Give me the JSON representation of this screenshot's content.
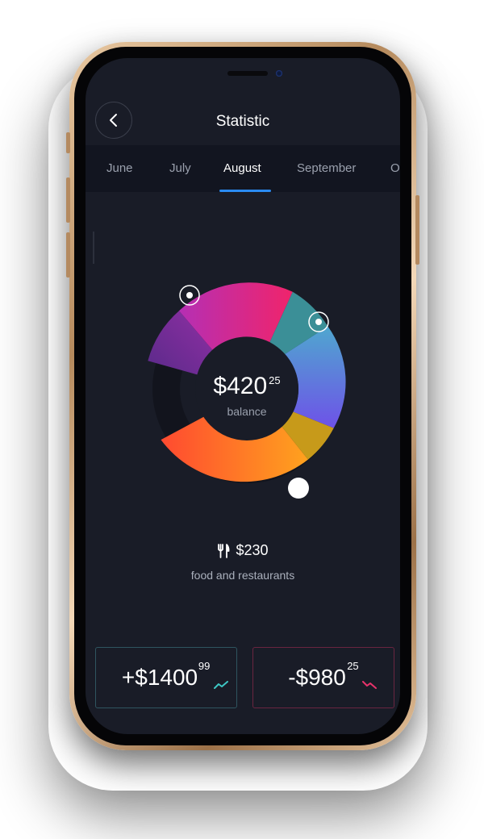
{
  "header": {
    "title": "Statistic"
  },
  "tabs": [
    {
      "label": "June",
      "active": false
    },
    {
      "label": "July",
      "active": false
    },
    {
      "label": "August",
      "active": true
    },
    {
      "label": "September",
      "active": false
    },
    {
      "label": "October",
      "active": false
    }
  ],
  "balance": {
    "amount": "$420",
    "cents": "25",
    "label": "balance"
  },
  "selected_category": {
    "icon": "fork-knife-icon",
    "amount": "$230",
    "label": "food and restaurants"
  },
  "income": {
    "amount": "+$1400",
    "cents": "99",
    "trend_icon": "trend-up-icon",
    "color": "#3ec7c4"
  },
  "expense": {
    "amount": "-$980",
    "cents": "25",
    "trend_icon": "trend-down-icon",
    "color": "#e8336b"
  },
  "colors": {
    "background": "#191c27",
    "accent": "#2a8bf2",
    "tab_bar": "#121520"
  }
}
